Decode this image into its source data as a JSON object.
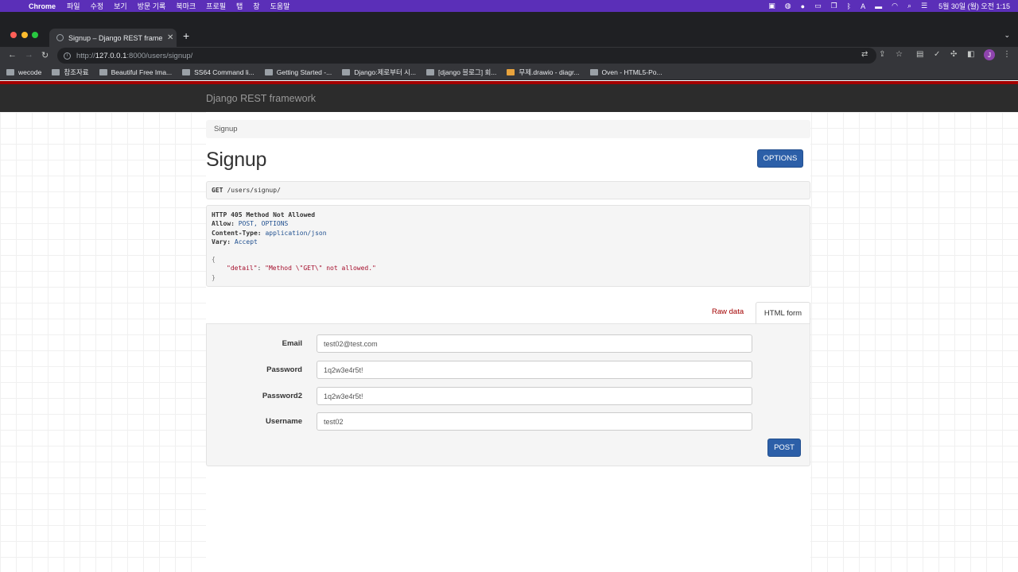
{
  "os_menubar": {
    "app_name": "Chrome",
    "menus": [
      "파일",
      "수정",
      "보기",
      "방문 기록",
      "북마크",
      "프로필",
      "탭",
      "창",
      "도움말"
    ],
    "clock": "5월 30일 (월) 오전 1:15"
  },
  "browser": {
    "tab_title": "Signup – Django REST framew",
    "url_host": "127.0.0.1",
    "url_scheme": "http://",
    "url_rest": ":8000/users/signup/",
    "profile_initial": "J",
    "bookmarks": [
      "wecode",
      "참조자료",
      "Beautiful Free Ima...",
      "SS64 Command li...",
      "Getting Started -...",
      "Django:제로부터 시...",
      "[django 블로그] 회...",
      "무제.drawio - diagr...",
      "Oven - HTML5-Po..."
    ]
  },
  "drf": {
    "brand": "Django REST framework",
    "breadcrumb": "Signup",
    "page_title": "Signup",
    "options_label": "OPTIONS",
    "request": {
      "method": "GET",
      "path": "/users/signup/"
    },
    "response": {
      "status": "HTTP 405 Method Not Allowed",
      "headers": [
        {
          "name": "Allow:",
          "value": "POST, OPTIONS"
        },
        {
          "name": "Content-Type:",
          "value": "application/json"
        },
        {
          "name": "Vary:",
          "value": "Accept"
        }
      ],
      "json_open": "{",
      "json_key": "\"detail\"",
      "json_value": "\"Method \\\"GET\\\" not allowed.\"",
      "json_close": "}"
    },
    "tabs": {
      "raw": "Raw data",
      "html": "HTML form"
    },
    "form": {
      "fields": [
        {
          "label": "Email",
          "value": "test02@test.com"
        },
        {
          "label": "Password",
          "value": "1q2w3e4r5t!"
        },
        {
          "label": "Password2",
          "value": "1q2w3e4r5t!"
        },
        {
          "label": "Username",
          "value": "test02"
        }
      ],
      "submit_label": "POST"
    }
  }
}
